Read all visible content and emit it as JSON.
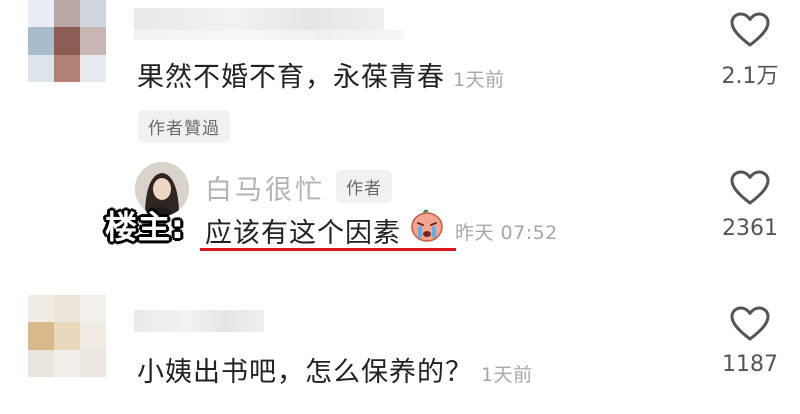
{
  "comments": [
    {
      "text": "果然不婚不育，永葆青春",
      "time": "1天前",
      "liked_badge": "作者贊過",
      "like_count": "2.1万"
    },
    {
      "op_label": "楼主:",
      "author_name": "白马很忙",
      "author_tag": "作者",
      "text": "应该有这个因素",
      "emoji": "crying-face",
      "time": "昨天 07:52",
      "like_count": "2361"
    },
    {
      "text": "小姨出书吧，怎么保养的？",
      "time": "1天前",
      "like_count": "1187"
    }
  ],
  "colors": {
    "highlight_underline": "#d7191f",
    "time_gray": "#a8a8a8"
  }
}
